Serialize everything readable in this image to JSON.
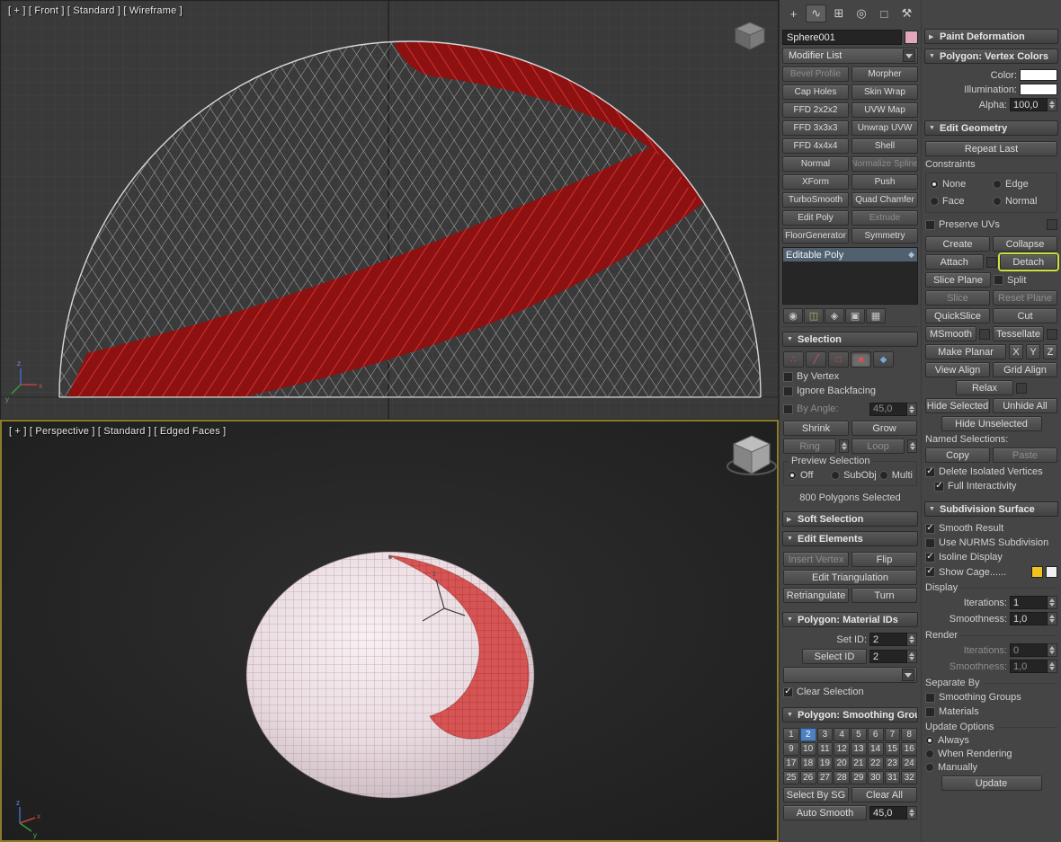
{
  "colors": {
    "object_color_swatch": "#e2a7b8",
    "vertex_color_swatch": "#ffffff",
    "illumination_swatch": "#ffffff",
    "cage_color_swatch": "#f2c21e",
    "cage_selected_swatch": "#f0f0f0",
    "selected_polygons_red": "#c52222",
    "smoothing_group_active": "#4f80c0",
    "detach_highlight_outline": "#cfe13c",
    "active_viewport_border": "#8a7d2a"
  },
  "icons": {
    "arrow_open": "▼",
    "arrow_closed": "▶",
    "create": "+",
    "modify": "∿",
    "hierarchy": "⊞",
    "motion": "◎",
    "display": "□",
    "utilities": "⚒",
    "vertex": "∴",
    "edge": "╱",
    "border": "□",
    "polygon": "■",
    "element": "◆",
    "pin": "◉",
    "show_end_result": "◫",
    "make_unique": "◈",
    "remove_modifier": "▣",
    "configure": "▦",
    "stack_item": "◆"
  },
  "viewports": {
    "front_label": "[ + ]  [ Front ]  [ Standard ]  [ Wireframe ]",
    "persp_label": "[ + ]  [ Perspective ]  [ Standard ]  [ Edged Faces ]"
  },
  "object": {
    "name": "Sphere001"
  },
  "modifier_list": {
    "label": "Modifier List"
  },
  "modifier_buttons": [
    [
      "Bevel Profile",
      "Morpher"
    ],
    [
      "Cap Holes",
      "Skin Wrap"
    ],
    [
      "FFD 2x2x2",
      "UVW Map"
    ],
    [
      "FFD 3x3x3",
      "Unwrap UVW"
    ],
    [
      "FFD 4x4x4",
      "Shell"
    ],
    [
      "Normal",
      "Normalize Spline"
    ],
    [
      "XForm",
      "Push"
    ],
    [
      "TurboSmooth",
      "Quad Chamfer"
    ],
    [
      "Edit Poly",
      "Extrude"
    ],
    [
      "FloorGenerator",
      "Symmetry"
    ]
  ],
  "stack": {
    "item": "Editable Poly"
  },
  "selection": {
    "title": "Selection",
    "by_vertex": "By Vertex",
    "ignore_backfacing": "Ignore Backfacing",
    "by_angle": "By Angle:",
    "by_angle_value": "45,0",
    "shrink": "Shrink",
    "grow": "Grow",
    "ring": "Ring",
    "loop": "Loop",
    "preview_selection": "Preview Selection",
    "off": "Off",
    "subobj": "SubObj",
    "multi": "Multi",
    "status": "800 Polygons Selected"
  },
  "soft_selection": {
    "title": "Soft Selection"
  },
  "edit_elements": {
    "title": "Edit Elements",
    "insert_vertex": "Insert Vertex",
    "flip": "Flip",
    "edit_triangulation": "Edit Triangulation",
    "retriangulate": "Retriangulate",
    "turn": "Turn"
  },
  "material_ids": {
    "title": "Polygon: Material IDs",
    "set_id": "Set ID:",
    "set_id_value": "2",
    "select_id": "Select ID",
    "select_id_value": "2",
    "clear_selection": "Clear Selection"
  },
  "smoothing_groups": {
    "title": "Polygon: Smoothing Grou",
    "numbers": [
      "1",
      "2",
      "3",
      "4",
      "5",
      "6",
      "7",
      "8",
      "9",
      "10",
      "11",
      "12",
      "13",
      "14",
      "15",
      "16",
      "17",
      "18",
      "19",
      "20",
      "21",
      "22",
      "23",
      "24",
      "25",
      "26",
      "27",
      "28",
      "29",
      "30",
      "31",
      "32"
    ],
    "select_by_sg": "Select By SG",
    "clear_all": "Clear All",
    "auto_smooth": "Auto Smooth",
    "auto_smooth_value": "45,0"
  },
  "paint_deformation": {
    "title": "Paint Deformation"
  },
  "vertex_colors": {
    "title": "Polygon: Vertex Colors",
    "color": "Color:",
    "illumination": "Illumination:",
    "alpha": "Alpha:",
    "alpha_value": "100,0"
  },
  "edit_geometry": {
    "title": "Edit Geometry",
    "repeat_last": "Repeat Last",
    "constraints": "Constraints",
    "none": "None",
    "edge": "Edge",
    "face": "Face",
    "normal": "Normal",
    "preserve_uvs": "Preserve UVs",
    "create": "Create",
    "collapse": "Collapse",
    "attach": "Attach",
    "detach": "Detach",
    "slice_plane": "Slice Plane",
    "split": "Split",
    "slice": "Slice",
    "reset_plane": "Reset Plane",
    "quickslice": "QuickSlice",
    "cut": "Cut",
    "msmooth": "MSmooth",
    "tessellate": "Tessellate",
    "make_planar": "Make Planar",
    "x": "X",
    "y": "Y",
    "z": "Z",
    "view_align": "View Align",
    "grid_align": "Grid Align",
    "relax": "Relax",
    "hide_selected": "Hide Selected",
    "unhide_all": "Unhide All",
    "hide_unselected": "Hide Unselected",
    "named_selections": "Named Selections:",
    "copy": "Copy",
    "paste": "Paste",
    "delete_isolated_vertices": "Delete Isolated Vertices",
    "full_interactivity": "Full Interactivity"
  },
  "subdivision_surface": {
    "title": "Subdivision Surface",
    "smooth_result": "Smooth Result",
    "use_nurms": "Use NURMS Subdivision",
    "isoline_display": "Isoline Display",
    "show_cage": "Show Cage......",
    "display": "Display",
    "iterations": "Iterations:",
    "display_iterations_value": "1",
    "smoothness": "Smoothness:",
    "display_smoothness_value": "1,0",
    "render": "Render",
    "render_iterations_value": "0",
    "render_smoothness_value": "1,0",
    "separate_by": "Separate By",
    "smoothing_groups": "Smoothing Groups",
    "materials": "Materials",
    "update_options": "Update Options",
    "always": "Always",
    "when_rendering": "When Rendering",
    "manually": "Manually",
    "update": "Update"
  }
}
